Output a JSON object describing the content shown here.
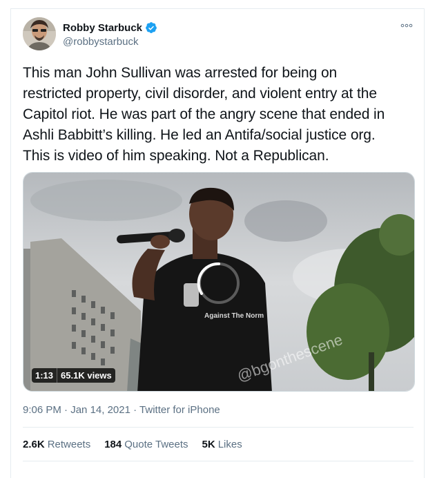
{
  "author": {
    "name": "Robby Starbuck",
    "handle": "@robbystarbuck",
    "verified": true,
    "avatar_icon": "avatar-photo",
    "verified_icon": "verified-badge-icon",
    "more_icon": "more-options-icon"
  },
  "tweet": {
    "lines": [
      "This man John Sullivan was arrested for being on",
      "restricted property, civil disorder, and violent entry at the",
      "Capitol riot. He was part of the angry scene that ended in",
      "Ashli Babbitt’s killing. He led an Antifa/social justice org.",
      "This is video of him speaking. Not a Republican."
    ]
  },
  "media": {
    "type": "video",
    "duration": "1:13",
    "views": "65.1K views",
    "shirt_text": "Against The Norm",
    "watermark": "@bgonthescene",
    "loading_icon": "loading-spinner-icon"
  },
  "meta": {
    "time": "9:06 PM",
    "separator": "·",
    "date": "Jan 14, 2021",
    "source": "Twitter for iPhone"
  },
  "stats": {
    "retweets_count": "2.6K",
    "retweets_label": "Retweets",
    "quotes_count": "184",
    "quotes_label": "Quote Tweets",
    "likes_count": "5K",
    "likes_label": "Likes"
  },
  "colors": {
    "verified_blue": "#1da1f2",
    "secondary_text": "#5b7083",
    "primary_text": "#0f1419",
    "border": "#e6ecf0"
  }
}
